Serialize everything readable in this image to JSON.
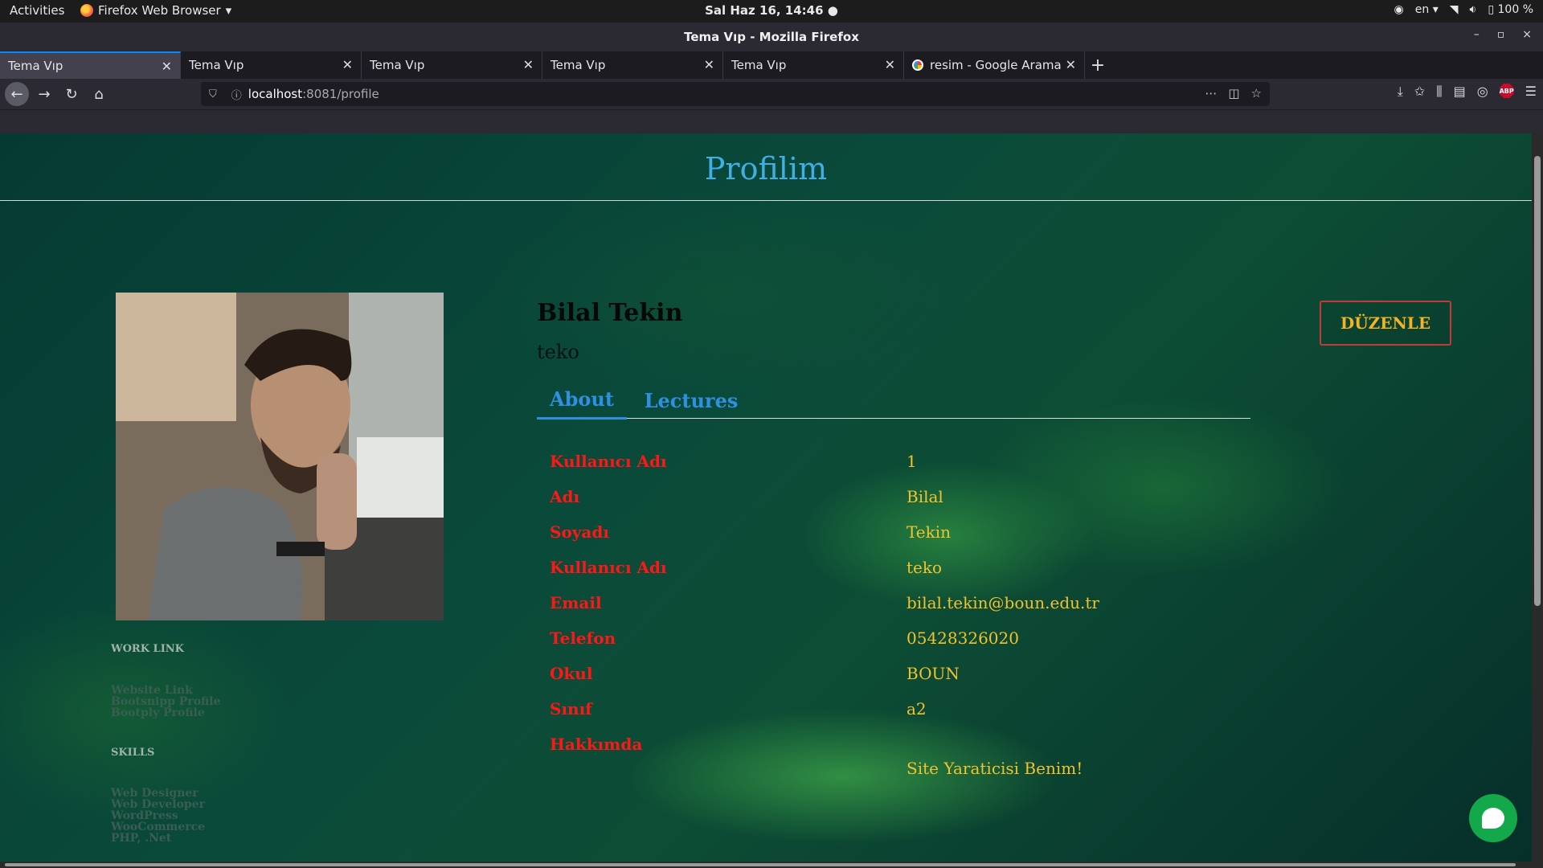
{
  "system": {
    "activities_label": "Activities",
    "app_name": "Firefox Web Browser",
    "clock": "Sal Haz 16, 14:46",
    "language": "en",
    "battery": "100 %"
  },
  "window": {
    "title": "Tema Vıp - Mozilla Firefox"
  },
  "tabs": [
    {
      "label": "Tema Vıp",
      "active": true
    },
    {
      "label": "Tema Vıp",
      "active": false
    },
    {
      "label": "Tema Vıp",
      "active": false
    },
    {
      "label": "Tema Vıp",
      "active": false
    },
    {
      "label": "Tema Vıp",
      "active": false
    },
    {
      "label": "resim - Google Arama",
      "active": false
    }
  ],
  "address_bar": {
    "host": "localhost",
    "rest": ":8081/profile"
  },
  "page": {
    "title": "Profilim",
    "user": {
      "full_name": "Bilal Tekin",
      "handle": "teko"
    },
    "edit_button": "DÜZENLE",
    "tabs": {
      "about": "About",
      "lectures": "Lectures"
    },
    "sidebar": {
      "work_link_heading": "WORK LINK",
      "work_links": [
        "Website Link",
        "Bootsnipp Profile",
        "Bootply Profile"
      ],
      "skills_heading": "SKILLS",
      "skills": [
        "Web Designer",
        "Web Developer",
        "WordPress",
        "WooCommerce",
        "PHP, .Net"
      ]
    },
    "about_fields": [
      {
        "label": "Kullanıcı Adı",
        "value": "1"
      },
      {
        "label": "Adı",
        "value": "Bilal"
      },
      {
        "label": "Soyadı",
        "value": "Tekin"
      },
      {
        "label": "Kullanıcı Adı",
        "value": "teko"
      },
      {
        "label": "Email",
        "value": "bilal.tekin@boun.edu.tr"
      },
      {
        "label": "Telefon",
        "value": "05428326020"
      },
      {
        "label": "Okul",
        "value": "BOUN"
      },
      {
        "label": "Sınıf",
        "value": "a2"
      },
      {
        "label": "Hakkımda",
        "value": ""
      }
    ],
    "about_me_text": "Site Yaraticisi Benim!"
  },
  "colors": {
    "title": "#3fb0e6",
    "label": "#ff1616",
    "value": "#f2c22a",
    "tab": "#2f8fe0",
    "chat": "#13a84a"
  }
}
